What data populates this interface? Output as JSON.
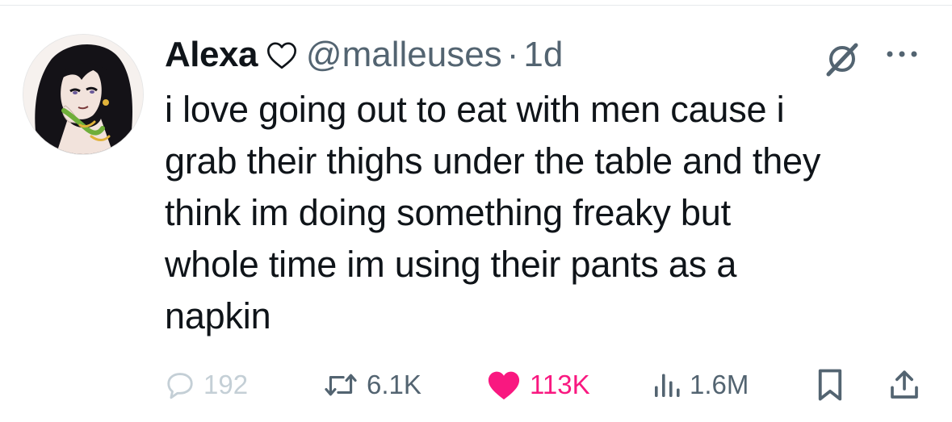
{
  "author": {
    "display_name": "Alexa",
    "handle": "@malleuses",
    "separator": "·",
    "time": "1d"
  },
  "tweet": {
    "text": "i love going out to eat with men cause i\ngrab their thighs under the table and they\nthink im doing something freaky but\nwhole time im using their pants as a\nnapkin"
  },
  "actions": {
    "replies": "192",
    "reposts": "6.1K",
    "likes": "113K",
    "views": "1.6M"
  },
  "colors": {
    "text": "#0f1419",
    "secondary": "#536471",
    "muted": "#c4cfd6",
    "like": "#f91880"
  },
  "icons": {
    "name_suffix": "heart-outline-icon",
    "grok": "grok-icon",
    "more": "more-dots-icon",
    "reply": "reply-bubble-icon",
    "repost": "repost-icon",
    "like": "heart-filled-icon",
    "views": "views-bars-icon",
    "bookmark": "bookmark-icon",
    "share": "share-icon"
  }
}
